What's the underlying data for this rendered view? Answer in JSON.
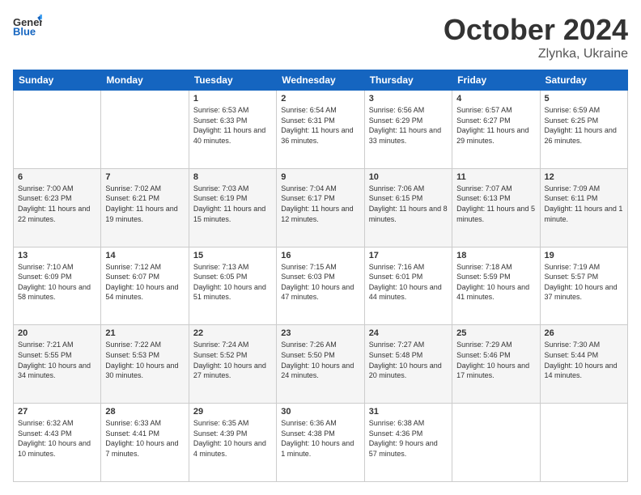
{
  "header": {
    "logo_general": "General",
    "logo_blue": "Blue",
    "month": "October 2024",
    "location": "Zlynka, Ukraine"
  },
  "days_of_week": [
    "Sunday",
    "Monday",
    "Tuesday",
    "Wednesday",
    "Thursday",
    "Friday",
    "Saturday"
  ],
  "weeks": [
    [
      {
        "day": "",
        "sunrise": "",
        "sunset": "",
        "daylight": ""
      },
      {
        "day": "",
        "sunrise": "",
        "sunset": "",
        "daylight": ""
      },
      {
        "day": "1",
        "sunrise": "Sunrise: 6:53 AM",
        "sunset": "Sunset: 6:33 PM",
        "daylight": "Daylight: 11 hours and 40 minutes."
      },
      {
        "day": "2",
        "sunrise": "Sunrise: 6:54 AM",
        "sunset": "Sunset: 6:31 PM",
        "daylight": "Daylight: 11 hours and 36 minutes."
      },
      {
        "day": "3",
        "sunrise": "Sunrise: 6:56 AM",
        "sunset": "Sunset: 6:29 PM",
        "daylight": "Daylight: 11 hours and 33 minutes."
      },
      {
        "day": "4",
        "sunrise": "Sunrise: 6:57 AM",
        "sunset": "Sunset: 6:27 PM",
        "daylight": "Daylight: 11 hours and 29 minutes."
      },
      {
        "day": "5",
        "sunrise": "Sunrise: 6:59 AM",
        "sunset": "Sunset: 6:25 PM",
        "daylight": "Daylight: 11 hours and 26 minutes."
      }
    ],
    [
      {
        "day": "6",
        "sunrise": "Sunrise: 7:00 AM",
        "sunset": "Sunset: 6:23 PM",
        "daylight": "Daylight: 11 hours and 22 minutes."
      },
      {
        "day": "7",
        "sunrise": "Sunrise: 7:02 AM",
        "sunset": "Sunset: 6:21 PM",
        "daylight": "Daylight: 11 hours and 19 minutes."
      },
      {
        "day": "8",
        "sunrise": "Sunrise: 7:03 AM",
        "sunset": "Sunset: 6:19 PM",
        "daylight": "Daylight: 11 hours and 15 minutes."
      },
      {
        "day": "9",
        "sunrise": "Sunrise: 7:04 AM",
        "sunset": "Sunset: 6:17 PM",
        "daylight": "Daylight: 11 hours and 12 minutes."
      },
      {
        "day": "10",
        "sunrise": "Sunrise: 7:06 AM",
        "sunset": "Sunset: 6:15 PM",
        "daylight": "Daylight: 11 hours and 8 minutes."
      },
      {
        "day": "11",
        "sunrise": "Sunrise: 7:07 AM",
        "sunset": "Sunset: 6:13 PM",
        "daylight": "Daylight: 11 hours and 5 minutes."
      },
      {
        "day": "12",
        "sunrise": "Sunrise: 7:09 AM",
        "sunset": "Sunset: 6:11 PM",
        "daylight": "Daylight: 11 hours and 1 minute."
      }
    ],
    [
      {
        "day": "13",
        "sunrise": "Sunrise: 7:10 AM",
        "sunset": "Sunset: 6:09 PM",
        "daylight": "Daylight: 10 hours and 58 minutes."
      },
      {
        "day": "14",
        "sunrise": "Sunrise: 7:12 AM",
        "sunset": "Sunset: 6:07 PM",
        "daylight": "Daylight: 10 hours and 54 minutes."
      },
      {
        "day": "15",
        "sunrise": "Sunrise: 7:13 AM",
        "sunset": "Sunset: 6:05 PM",
        "daylight": "Daylight: 10 hours and 51 minutes."
      },
      {
        "day": "16",
        "sunrise": "Sunrise: 7:15 AM",
        "sunset": "Sunset: 6:03 PM",
        "daylight": "Daylight: 10 hours and 47 minutes."
      },
      {
        "day": "17",
        "sunrise": "Sunrise: 7:16 AM",
        "sunset": "Sunset: 6:01 PM",
        "daylight": "Daylight: 10 hours and 44 minutes."
      },
      {
        "day": "18",
        "sunrise": "Sunrise: 7:18 AM",
        "sunset": "Sunset: 5:59 PM",
        "daylight": "Daylight: 10 hours and 41 minutes."
      },
      {
        "day": "19",
        "sunrise": "Sunrise: 7:19 AM",
        "sunset": "Sunset: 5:57 PM",
        "daylight": "Daylight: 10 hours and 37 minutes."
      }
    ],
    [
      {
        "day": "20",
        "sunrise": "Sunrise: 7:21 AM",
        "sunset": "Sunset: 5:55 PM",
        "daylight": "Daylight: 10 hours and 34 minutes."
      },
      {
        "day": "21",
        "sunrise": "Sunrise: 7:22 AM",
        "sunset": "Sunset: 5:53 PM",
        "daylight": "Daylight: 10 hours and 30 minutes."
      },
      {
        "day": "22",
        "sunrise": "Sunrise: 7:24 AM",
        "sunset": "Sunset: 5:52 PM",
        "daylight": "Daylight: 10 hours and 27 minutes."
      },
      {
        "day": "23",
        "sunrise": "Sunrise: 7:26 AM",
        "sunset": "Sunset: 5:50 PM",
        "daylight": "Daylight: 10 hours and 24 minutes."
      },
      {
        "day": "24",
        "sunrise": "Sunrise: 7:27 AM",
        "sunset": "Sunset: 5:48 PM",
        "daylight": "Daylight: 10 hours and 20 minutes."
      },
      {
        "day": "25",
        "sunrise": "Sunrise: 7:29 AM",
        "sunset": "Sunset: 5:46 PM",
        "daylight": "Daylight: 10 hours and 17 minutes."
      },
      {
        "day": "26",
        "sunrise": "Sunrise: 7:30 AM",
        "sunset": "Sunset: 5:44 PM",
        "daylight": "Daylight: 10 hours and 14 minutes."
      }
    ],
    [
      {
        "day": "27",
        "sunrise": "Sunrise: 6:32 AM",
        "sunset": "Sunset: 4:43 PM",
        "daylight": "Daylight: 10 hours and 10 minutes."
      },
      {
        "day": "28",
        "sunrise": "Sunrise: 6:33 AM",
        "sunset": "Sunset: 4:41 PM",
        "daylight": "Daylight: 10 hours and 7 minutes."
      },
      {
        "day": "29",
        "sunrise": "Sunrise: 6:35 AM",
        "sunset": "Sunset: 4:39 PM",
        "daylight": "Daylight: 10 hours and 4 minutes."
      },
      {
        "day": "30",
        "sunrise": "Sunrise: 6:36 AM",
        "sunset": "Sunset: 4:38 PM",
        "daylight": "Daylight: 10 hours and 1 minute."
      },
      {
        "day": "31",
        "sunrise": "Sunrise: 6:38 AM",
        "sunset": "Sunset: 4:36 PM",
        "daylight": "Daylight: 9 hours and 57 minutes."
      },
      {
        "day": "",
        "sunrise": "",
        "sunset": "",
        "daylight": ""
      },
      {
        "day": "",
        "sunrise": "",
        "sunset": "",
        "daylight": ""
      }
    ]
  ]
}
